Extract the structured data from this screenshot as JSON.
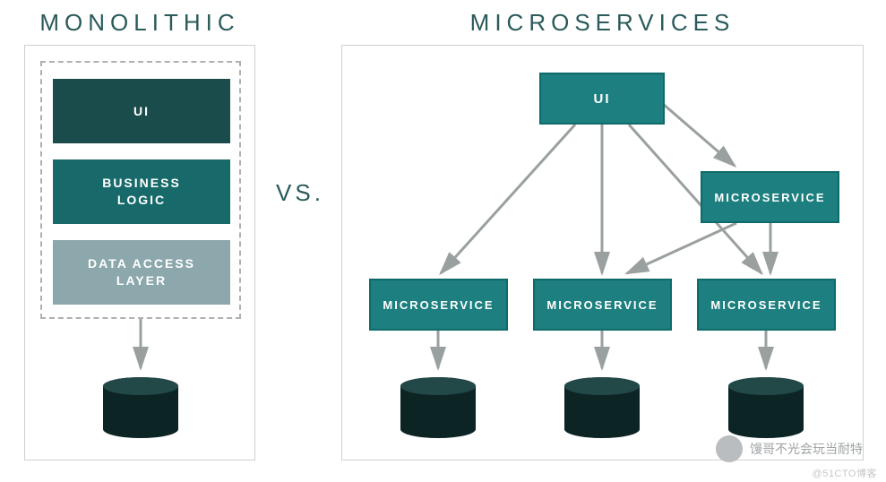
{
  "headings": {
    "left": "MONOLITHIC",
    "right": "MICROSERVICES",
    "vs": "VS."
  },
  "monolithic": {
    "layers": {
      "ui": "UI",
      "business": "BUSINESS\nLOGIC",
      "data": "DATA ACCESS\nLAYER"
    }
  },
  "microservices": {
    "nodes": {
      "ui": "UI",
      "ms_right": "MICROSERVICE",
      "ms1": "MICROSERVICE",
      "ms2": "MICROSERVICE",
      "ms3": "MICROSERVICE"
    }
  },
  "footer": {
    "watermark": "@51CTO博客",
    "wechat_caption": "馒哥不光会玩当耐特"
  }
}
